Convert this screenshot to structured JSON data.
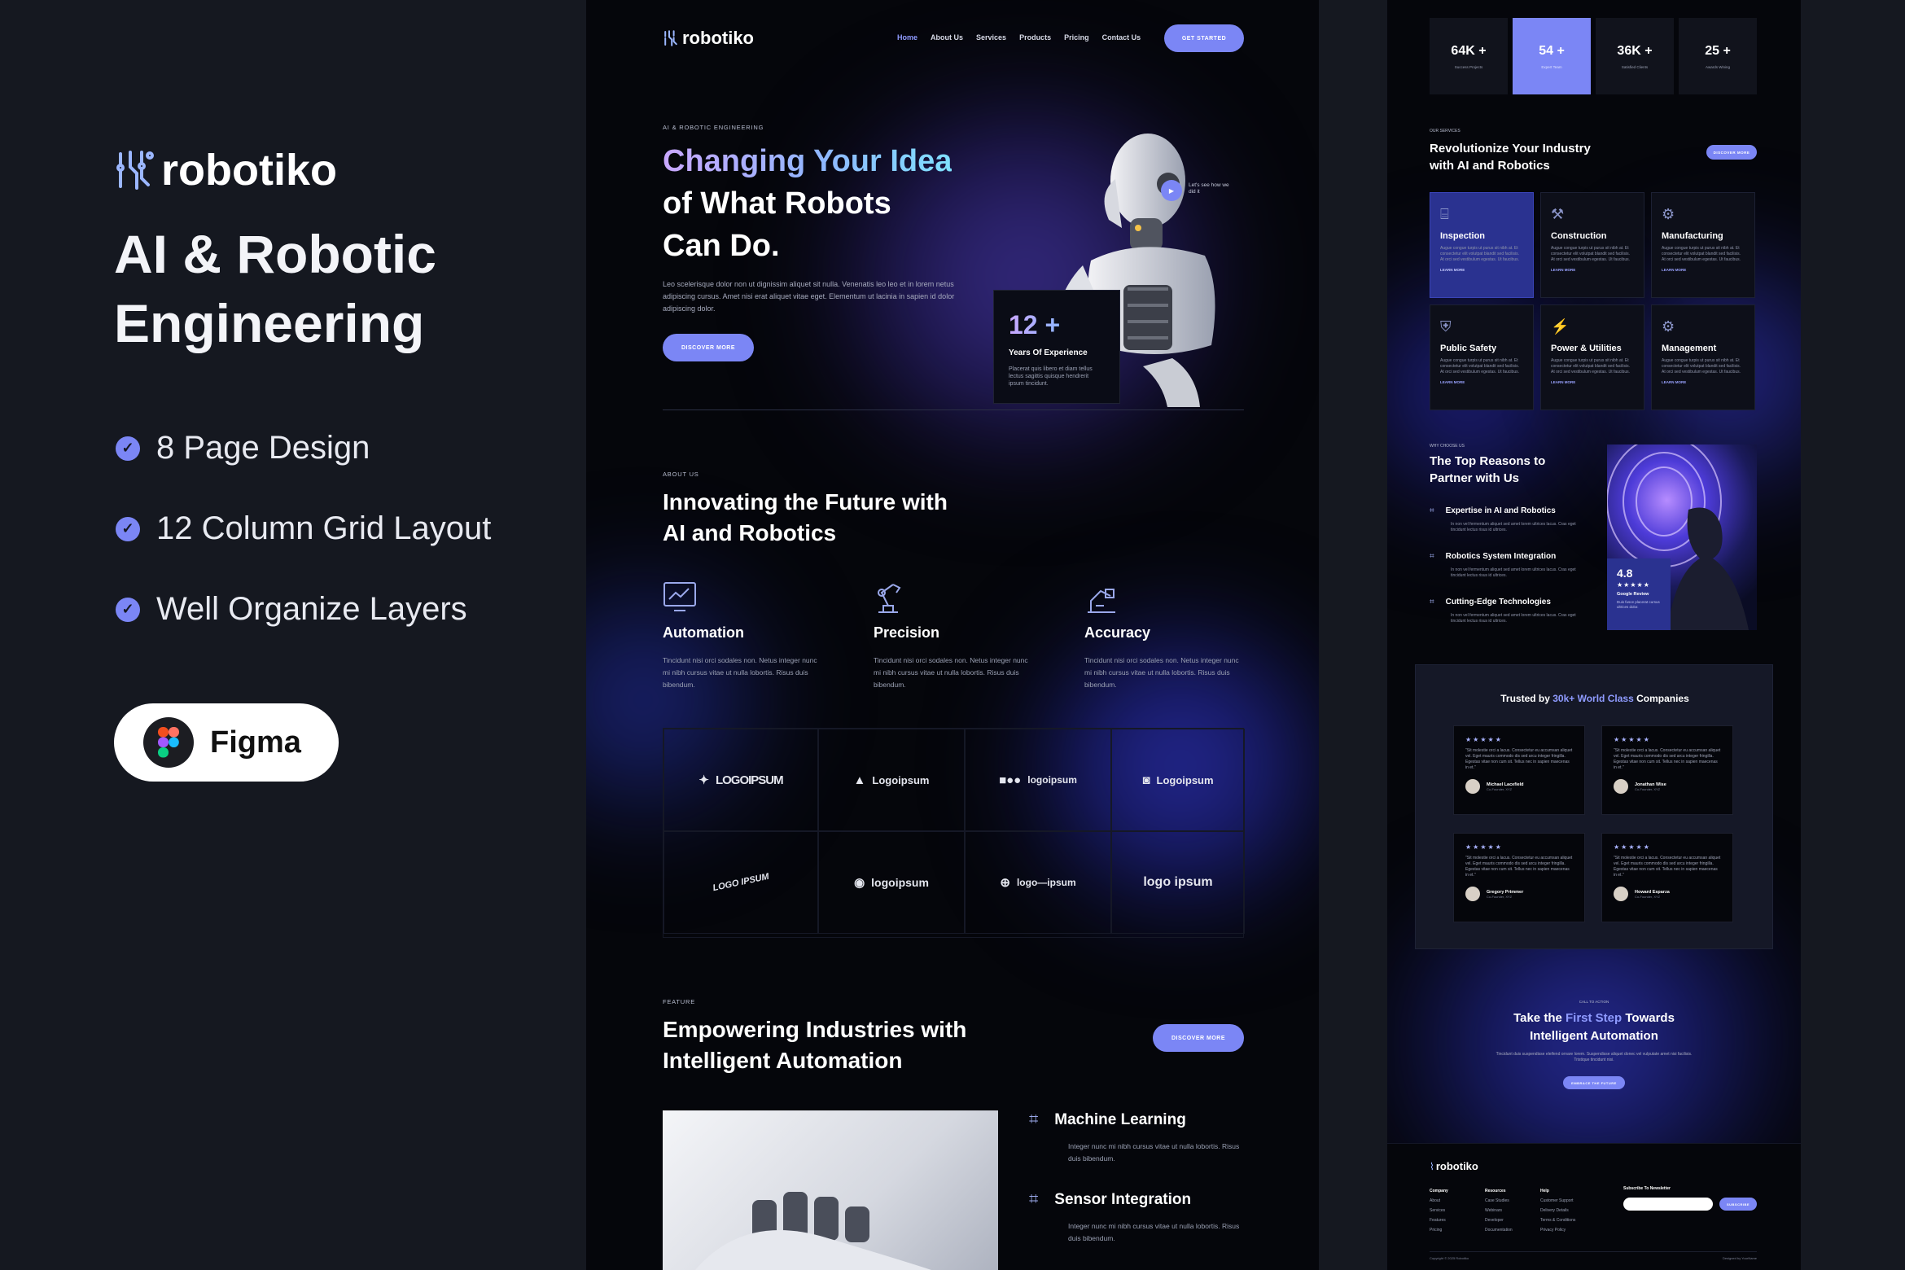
{
  "brand": {
    "name": "robotiko"
  },
  "left": {
    "title_line1": "AI & Robotic",
    "title_line2": "Engineering",
    "features": [
      "8 Page Design",
      "12 Column Grid Layout",
      "Well Organize Layers"
    ],
    "badge": "Figma"
  },
  "nav": {
    "items": [
      "Home",
      "About Us",
      "Services",
      "Products",
      "Pricing",
      "Contact Us"
    ],
    "cta": "GET STARTED"
  },
  "hero": {
    "eyebrow": "AI & ROBOTIC ENGINEERING",
    "title_grad": "Changing Your Idea",
    "title_rest1": "of What Robots",
    "title_rest2": "Can Do.",
    "desc": "Leo scelerisque dolor non ut dignissim aliquet sit nulla. Venenatis leo leo et in lorem netus adipiscing cursus. Amet nisi erat aliquet vitae eget. Elementum ut lacinia in sapien id dolor adipiscing dolor.",
    "cta": "DISCOVER MORE",
    "video_label": "Let's see how we did it",
    "exp_number": "12 +",
    "exp_title": "Years Of Experience",
    "exp_desc": "Placerat quis libero et diam tellus lectus sagittis quisque hendrerit ipsum tincidunt."
  },
  "about": {
    "eyebrow": "ABOUT US",
    "title1": "Innovating the Future with",
    "title2": "AI and Robotics",
    "items": [
      {
        "title": "Automation",
        "desc": "Tincidunt nisi orci sodales non. Netus integer nunc mi nibh cursus vitae ut nulla lobortis. Risus duis bibendum."
      },
      {
        "title": "Precision",
        "desc": "Tincidunt nisi orci sodales non. Netus integer nunc mi nibh cursus vitae ut nulla lobortis. Risus duis bibendum."
      },
      {
        "title": "Accuracy",
        "desc": "Tincidunt nisi orci sodales non. Netus integer nunc mi nibh cursus vitae ut nulla lobortis. Risus duis bibendum."
      }
    ]
  },
  "logos": [
    "LOGOIPSUM",
    "Logoipsum",
    "logoipsum",
    "Logoipsum",
    "LOGO IPSUM",
    "logoipsum",
    "logo—ipsum",
    "logo ipsum"
  ],
  "feature": {
    "eyebrow": "FEATURE",
    "title1": "Empowering Industries with",
    "title2": "Intelligent Automation",
    "cta": "DISCOVER MORE",
    "items": [
      {
        "title": "Machine Learning",
        "desc": "Integer nunc mi nibh cursus vitae ut nulla lobortis. Risus duis bibendum."
      },
      {
        "title": "Sensor Integration",
        "desc": "Integer nunc mi nibh cursus vitae ut nulla lobortis. Risus duis bibendum."
      }
    ]
  },
  "stats": [
    {
      "n": "64K +",
      "c": "Success Projects"
    },
    {
      "n": "54 +",
      "c": "Expert Team"
    },
    {
      "n": "36K +",
      "c": "Satisfied Clients"
    },
    {
      "n": "25 +",
      "c": "Awards Wining"
    }
  ],
  "services": {
    "eyebrow": "OUR SERVICES",
    "title1": "Revolutionize Your Industry",
    "title2": "with AI and Robotics",
    "cta": "DISCOVER MORE",
    "items": [
      {
        "title": "Inspection",
        "desc": "Augue congue turpis ut purus sit nibh at. Et consectetur elit volutpat blandit sed facilisis. At orci sed vestibulum egestas. Ut faucibus.",
        "link": "LEARN MORE"
      },
      {
        "title": "Construction",
        "desc": "Augue congue turpis ut purus sit nibh at. Et consectetur elit volutpat blandit sed facilisis. At orci sed vestibulum egestas. Ut faucibus.",
        "link": "LEARN MORE"
      },
      {
        "title": "Manufacturing",
        "desc": "Augue congue turpis ut purus sit nibh at. Et consectetur elit volutpat blandit sed facilisis. At orci sed vestibulum egestas. Ut faucibus.",
        "link": "LEARN MORE"
      },
      {
        "title": "Public Safety",
        "desc": "Augue congue turpis ut purus sit nibh at. Et consectetur elit volutpat blandit sed facilisis. At orci sed vestibulum egestas. Ut faucibus.",
        "link": "LEARN MORE"
      },
      {
        "title": "Power & Utilities",
        "desc": "Augue congue turpis ut purus sit nibh at. Et consectetur elit volutpat blandit sed facilisis. At orci sed vestibulum egestas. Ut faucibus.",
        "link": "LEARN MORE"
      },
      {
        "title": "Management",
        "desc": "Augue congue turpis ut purus sit nibh at. Et consectetur elit volutpat blandit sed facilisis. At orci sed vestibulum egestas. Ut faucibus.",
        "link": "LEARN MORE"
      }
    ]
  },
  "why": {
    "eyebrow": "WHY CHOOSE US",
    "title1": "The Top Reasons to",
    "title2": "Partner with Us",
    "items": [
      {
        "title": "Expertise in AI and Robotics",
        "desc": "In non vel fermentum aliquet sed amet lorem ultrices lacus. Cras eget tincidunt lectus risus id ultrices."
      },
      {
        "title": "Robotics System Integration",
        "desc": "In non vel fermentum aliquet sed amet lorem ultrices lacus. Cras eget tincidunt lectus risus id ultrices."
      },
      {
        "title": "Cutting-Edge Technologies",
        "desc": "In non vel fermentum aliquet sed amet lorem ultrices lacus. Cras eget tincidunt lectus risus id ultrices."
      }
    ],
    "rating": "4.8",
    "rating_label": "Google Review",
    "rating_desc": "Duis fusce placerat cursus ultrices dolor."
  },
  "trusted": {
    "prefix": "Trusted by ",
    "highlight": "30k+ World Class",
    "suffix": " Companies",
    "stars": "★★★★★",
    "quote": "\"Sit molestie orci a lacus. Consectetur eu accumsan aliquet vel. Eget mauris commodo dis sed arcu integer fringilla. Egestas vitae non cum sit. Tellus nec in sapien maecenas in et.\"",
    "reviews": [
      {
        "name": "Michael Lacefield",
        "role": "Co-Founder, XYZ"
      },
      {
        "name": "Jonathan Wise",
        "role": "Co-Founder, XYZ"
      },
      {
        "name": "Gregory Primmer",
        "role": "Co-Founder, XYZ"
      },
      {
        "name": "Howard Esparza",
        "role": "Co-Founder, XYZ"
      }
    ]
  },
  "cta": {
    "eyebrow": "CALL TO ACTION",
    "t1": "Take the ",
    "t_hl": "First Step",
    "t2": " Towards",
    "t3": "Intelligent Automation",
    "desc": "Tincidunt duis suspendisse eleifend ornare lorem. Suspendisse aliquet donec vel vulputate amet nisi facilisis. Tristique tincidunt nisi.",
    "button": "EMBRACE THE FUTURE"
  },
  "footer": {
    "columns": [
      {
        "head": "Company",
        "links": [
          "About",
          "Services",
          "Features",
          "Pricing"
        ]
      },
      {
        "head": "Resources",
        "links": [
          "Case Studies",
          "Webinars",
          "Developer",
          "Documentation"
        ]
      },
      {
        "head": "Help",
        "links": [
          "Customer Support",
          "Delivery Details",
          "Terms & Conditions",
          "Privacy Policy"
        ]
      }
    ],
    "newsletter": "Subscribe To Newsletter",
    "newsletter_btn": "SUBSCRIBE",
    "copyright": "Copyright © 2025 Robotiko",
    "designed": "Designed by YourName"
  },
  "colors": {
    "accent": "#7b86f5",
    "bg": "#151820",
    "panel": "#05060b"
  }
}
